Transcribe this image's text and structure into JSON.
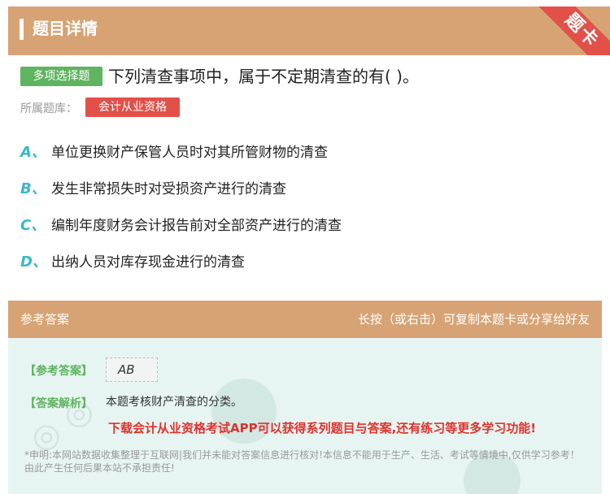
{
  "header": {
    "title": "题目详情",
    "ribbon": "题卡"
  },
  "question": {
    "type_badge": "多项选择题",
    "text": "下列清查事项中，属于不定期清查的有( )。",
    "bank_label": "所属题库：",
    "bank": "会计从业资格"
  },
  "options": [
    {
      "letter": "A、",
      "text": "单位更换财产保管人员时对其所管财物的清查"
    },
    {
      "letter": "B、",
      "text": "发生非常损失时对受损资产进行的清查"
    },
    {
      "letter": "C、",
      "text": "编制年度财务会计报告前对全部资产进行的清查"
    },
    {
      "letter": "D、",
      "text": "出纳人员对库存现金进行的清查"
    }
  ],
  "answer_section": {
    "title": "参考答案",
    "hint": "长按（或右击）可复制本题卡或分享给好友",
    "answer_label": "【参考答案】",
    "answer": "AB",
    "explain_label": "【答案解析】",
    "explain": "本题考核财产清查的分类。",
    "promo": "下载会计从业资格考试APP可以获得系列题目与答案,还有练习等更多学习功能!",
    "disclaimer": "*申明:本网站数据收集整理于互联网|我们并未能对答案信息进行核对!本信息不能用于生产、生活、考试等情境中,仅供学习参考！由此产生任何后果本站不承担责任!"
  },
  "colors": {
    "header_bg": "#d7a374",
    "badge_green": "#5fb45f",
    "badge_red": "#e25049",
    "option_letter": "#3ab8c6"
  }
}
